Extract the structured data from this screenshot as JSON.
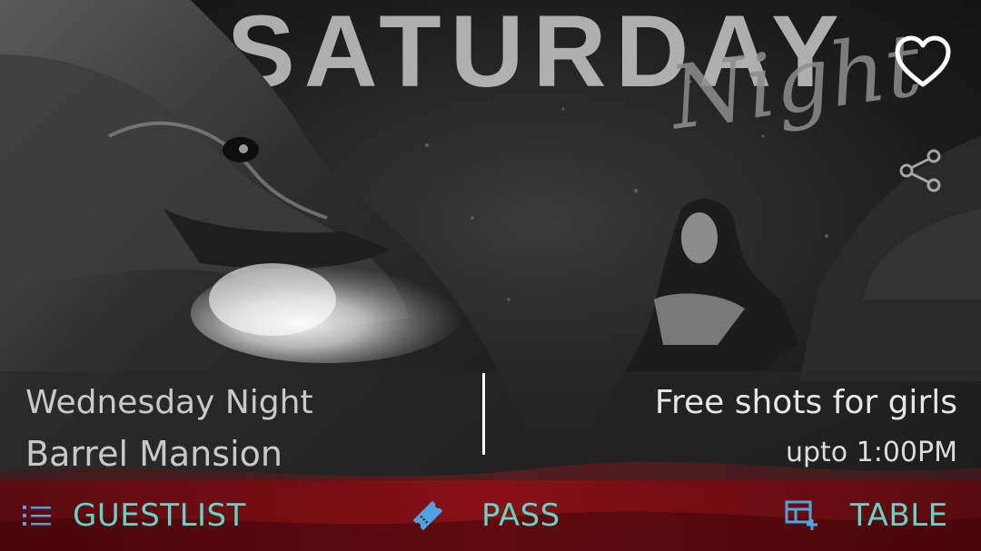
{
  "event": {
    "title": "Wednesday Night",
    "venue": "Barrel Mansion",
    "offer": "Free shots for girls",
    "offer_time": "upto 1:00PM"
  },
  "poster": {
    "headline": "SATURDAY",
    "script": "Night"
  },
  "actions": [
    {
      "label": "GUESTLIST",
      "icon": "list-icon"
    },
    {
      "label": "PASS",
      "icon": "ticket-icon"
    },
    {
      "label": "TABLE",
      "icon": "table-add-icon"
    }
  ],
  "top_icons": {
    "favorite": "heart-outline-icon",
    "share": "share-icon"
  },
  "colors": {
    "accent": "#5fd6c8",
    "icon_accent": "#4fa3e0",
    "band_red": "#7a0f14"
  }
}
